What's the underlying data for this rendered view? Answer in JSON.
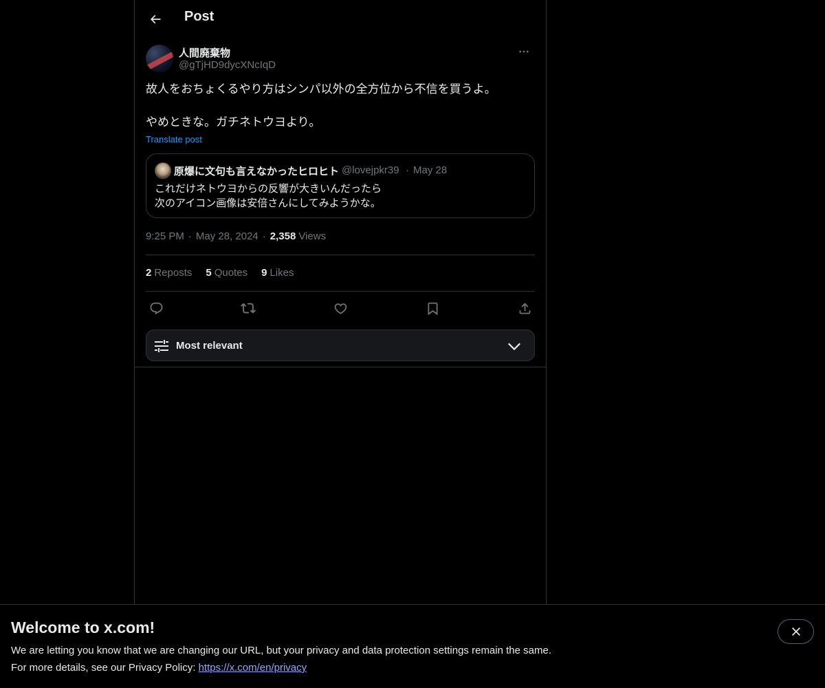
{
  "header": {
    "title": "Post"
  },
  "post": {
    "author": {
      "display_name": "人間廃棄物",
      "handle": "@gTjHD9dycXNcIqD"
    },
    "text": "故人をおちょくるやり方はシンパ以外の全方位から不信を買うよ。\n\nやめときな。ガチネトウヨより。",
    "translate_label": "Translate post",
    "quote": {
      "display_name": "原爆に文句も言えなかったヒロヒト",
      "handle": "@lovejpkr39",
      "separator": "·",
      "date": "May 28",
      "text": "これだけネトウヨからの反響が大きいんだったら\n次のアイコン画像は安倍さんにしてみようかな。"
    },
    "meta": {
      "time": "9:25 PM",
      "separator": "·",
      "date": "May 28, 2024",
      "views_count": "2,358",
      "views_label": "Views"
    },
    "stats": {
      "reposts_count": "2",
      "reposts_label": "Reposts",
      "quotes_count": "5",
      "quotes_label": "Quotes",
      "likes_count": "9",
      "likes_label": "Likes"
    }
  },
  "actions": {
    "icons": [
      "reply-icon",
      "repost-icon",
      "like-icon",
      "bookmark-icon",
      "share-icon"
    ]
  },
  "sort": {
    "label": "Most relevant"
  },
  "banner": {
    "title": "Welcome to x.com!",
    "line1": "We are letting you know that we are changing our URL, but your privacy and data protection settings remain the same.",
    "line2_prefix": "For more details, see our Privacy Policy: ",
    "link": "https://x.com/en/privacy"
  },
  "colors": {
    "background": "#000000",
    "text": "#e7e9ea",
    "muted": "#71767b",
    "accent": "#1d9bf0",
    "border": "#2f3336",
    "link": "#9aa5ff"
  }
}
